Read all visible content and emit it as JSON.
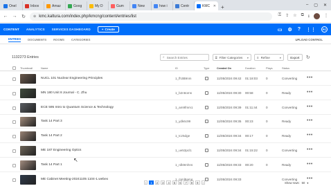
{
  "browser": {
    "tabs": [
      {
        "label": "Onel",
        "color": "#1a73e8",
        "active": false
      },
      {
        "label": "Inbox",
        "color": "#d93025",
        "active": false
      },
      {
        "label": "Amaz",
        "color": "#ff9900",
        "active": false
      },
      {
        "label": "Goog",
        "color": "#34a853",
        "active": false
      },
      {
        "label": "My D",
        "color": "#fbbc04",
        "active": false
      },
      {
        "label": "Gum",
        "color": "#ff5f5f",
        "active": false
      },
      {
        "label": "New",
        "color": "#4285f4",
        "active": false
      },
      {
        "label": "how i",
        "color": "#4285f4",
        "active": false
      },
      {
        "label": "Centr",
        "color": "#3c7bd6",
        "active": false
      },
      {
        "label": "KMC",
        "color": "#006efa",
        "active": true
      }
    ],
    "url": "kmc.kaltura.com/index.php/kmcng/content/entries/list"
  },
  "nav": {
    "items": [
      "CONTENT",
      "ANALYTICS",
      "SERVICES DASHBOARD"
    ],
    "create_label": "Create",
    "user_initials": "PC"
  },
  "subnav": {
    "tabs": [
      "ENTRIES",
      "DOCUMENTS",
      "ROOMS",
      "CATEGORIES"
    ],
    "upload_label": "UPLOAD CONTROL"
  },
  "toolbar": {
    "count": "1132273 Entries",
    "search_placeholder": "Search Entries",
    "filter_label": "Filter Categories",
    "refine_label": "Refine",
    "export_label": "Export"
  },
  "table": {
    "headers": {
      "thumbnail": "Thumbnail",
      "name": "Name",
      "id": "ID",
      "type": "Type",
      "created": "Created On",
      "duration": "Duration",
      "plays": "Plays",
      "status": "Status"
    },
    "rows": [
      {
        "name": "NUCL 101 Nuclear Engineering Principles",
        "id": "1_fh3B9nm",
        "created": "11/05/2024 09:42",
        "duration": "01:18:03",
        "plays": "0",
        "status": "Converting",
        "thumb": "#6b5a4c"
      },
      {
        "name": "MN 180 Unit 8 Journal - C. Zhu",
        "id": "1_b2n6oms",
        "created": "11/05/2024 09:30",
        "duration": "00:58",
        "plays": "0",
        "status": "Ready",
        "thumb": "#3f4a3c"
      },
      {
        "name": "ECE 595 Intro to Quantum Science & Technology",
        "id": "1_am9fmm1",
        "created": "11/05/2024 09:39",
        "duration": "01:11:44",
        "plays": "0",
        "status": "Converting",
        "thumb": "#5a5e63"
      },
      {
        "name": "Task 14 Part 3",
        "id": "1_ydk6c99",
        "created": "11/05/2024 09:35",
        "duration": "00:23",
        "plays": "0",
        "status": "Ready",
        "thumb": "#a08a7a"
      },
      {
        "name": "Task 14 Part 2",
        "id": "1_tcz5dge",
        "created": "11/05/2024 09:34",
        "duration": "00:17",
        "plays": "0",
        "status": "Ready",
        "thumb": "#9a8476"
      },
      {
        "name": "ME 187 Engineering Optics",
        "id": "1_ue53pcl1",
        "created": "11/05/2024 09:34",
        "duration": "01:15:22",
        "plays": "0",
        "status": "Converting",
        "thumb": "#6e6558"
      },
      {
        "name": "Task 14 Part 1",
        "id": "1_rdk9mhns",
        "created": "11/05/2024 09:33",
        "duration": "00:20",
        "plays": "0",
        "status": "Ready",
        "thumb": "#a38d80"
      },
      {
        "name": "ME Cabinet Meeting-20241105 1104-1.webex",
        "id": "1_mml9amq",
        "created": "11/05/2024 09:33",
        "duration": "",
        "plays": "",
        "status": "Converting",
        "thumb": "#2f3a4a"
      }
    ]
  },
  "pager": {
    "pages": [
      "1",
      "2",
      "3",
      "4",
      "5",
      "6",
      "7",
      "8",
      "9"
    ],
    "current": "1",
    "show_rows_label": "Show rows:",
    "rows_per_page": "50"
  }
}
